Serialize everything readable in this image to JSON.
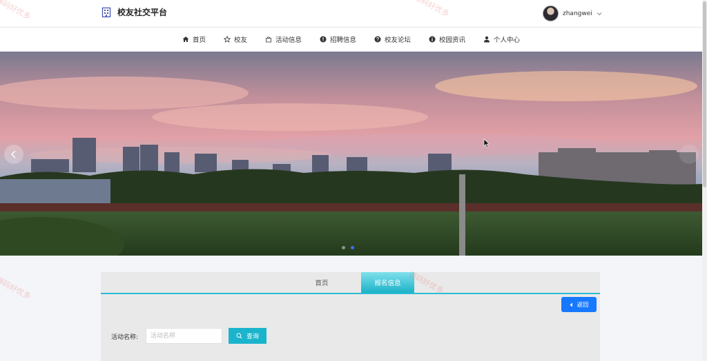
{
  "brand": {
    "title": "校友社交平台",
    "icon": "building-icon"
  },
  "user": {
    "name": "zhangwei",
    "icon": "chevron-down-icon"
  },
  "nav": {
    "items": [
      {
        "label": "首页",
        "icon": "home-icon"
      },
      {
        "label": "校友",
        "icon": "star-icon"
      },
      {
        "label": "活动信息",
        "icon": "bag-icon"
      },
      {
        "label": "招聘信息",
        "icon": "info-circle-icon"
      },
      {
        "label": "校友论坛",
        "icon": "question-circle-icon"
      },
      {
        "label": "校园资讯",
        "icon": "info-icon"
      },
      {
        "label": "个人中心",
        "icon": "user-icon"
      }
    ]
  },
  "banner": {
    "slides": 2,
    "active_slide": 2
  },
  "panel": {
    "tabs": [
      {
        "label": "首页"
      },
      {
        "label": "报名信息"
      }
    ],
    "back_label": "返回",
    "search": {
      "label": "活动名称:",
      "placeholder": "活动名称",
      "value": "",
      "button_label": "查询"
    }
  },
  "watermark": "源码好优多",
  "colors": {
    "accent": "#1ab4cc",
    "primary_button": "#1677ff",
    "dot_active": "#3b6ff5"
  }
}
